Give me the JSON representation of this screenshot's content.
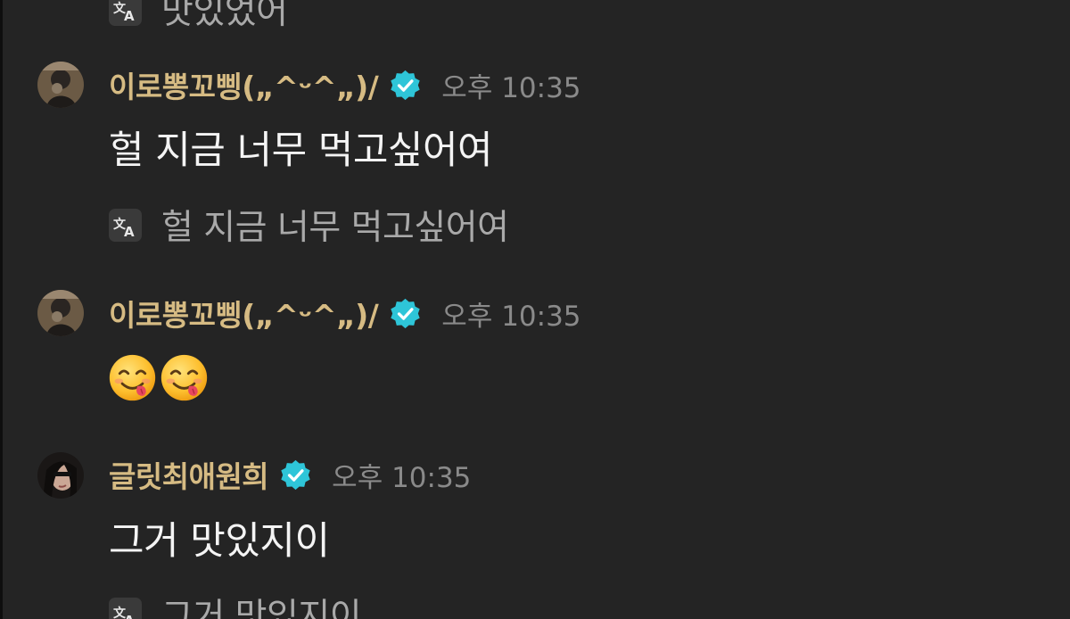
{
  "messages": [
    {
      "translation_partial": "맛있었어"
    },
    {
      "username": "이로뽕꼬삥(„^ᵕ^„)/",
      "verified": true,
      "time": "오후 10:35",
      "text": "헐 지금 너무 먹고싶어여",
      "translation": "헐 지금 너무 먹고싶어여"
    },
    {
      "username": "이로뽕꼬삥(„^ᵕ^„)/",
      "verified": true,
      "time": "오후 10:35",
      "emojis": [
        "yummy-face-emoji",
        "yummy-face-emoji"
      ]
    },
    {
      "username": "글릿최애원희",
      "verified": true,
      "time": "오후 10:35",
      "text": "그거 맛있지이",
      "translation": "그거 맛있지이"
    }
  ],
  "colors": {
    "background": "#242424",
    "username": "#d6bb83",
    "timestamp": "#8a8a8a",
    "message_text": "#f4f4f4",
    "translation_text": "#a9a9a9",
    "verified_badge": "#2ec5d8"
  },
  "icons": {
    "translate": "translate-icon",
    "verified": "verified-badge-icon"
  }
}
